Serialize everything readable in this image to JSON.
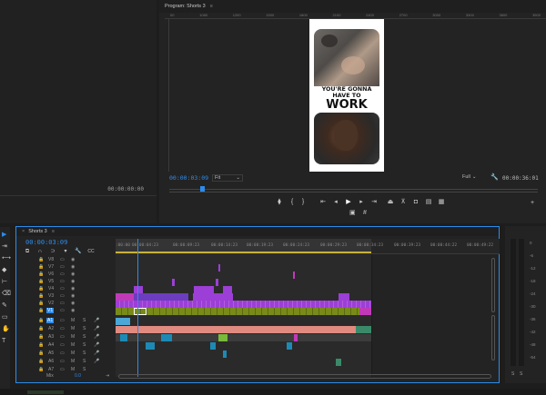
{
  "source": {
    "timecode": "00:00:00:00"
  },
  "program": {
    "title": "Program: Shorts 3",
    "menu_icon": "≡",
    "ruler_ticks": [
      "00",
      "1080",
      "1200",
      "1500",
      "1800",
      "2100",
      "2400",
      "2700",
      "3000",
      "3300",
      "3600",
      "3900"
    ],
    "caption_line1": "YOU'RE GONNA",
    "caption_line2": "HAVE TO",
    "caption_line3": "WORK",
    "current_tc": "00:00:03:09",
    "fit": "Fit",
    "quality": "Full",
    "duration_tc": "00:00:36:01"
  },
  "timeline": {
    "title": "Shorts 3",
    "close": "×",
    "current_tc": "00:00:03:09",
    "ruler": [
      ":00:00",
      "00:00:04:23",
      "00:00:09:23",
      "00:00:14:23",
      "00:00:19:23",
      "00:00:24:23",
      "00:00:29:23",
      "00:00:34:23",
      "00:00:39:23",
      "00:00:44:22",
      "00:00:49:22"
    ],
    "video_tracks": [
      "V8",
      "V7",
      "V6",
      "V5",
      "V4",
      "V3",
      "V2",
      "V1"
    ],
    "audio_tracks": [
      "A1",
      "A2",
      "A3",
      "A4",
      "A5",
      "A6",
      "A7"
    ],
    "mix_label": "Mix",
    "mix_value": "0.0",
    "m": "M",
    "s": "S"
  },
  "meter": {
    "scale": [
      "0",
      "-6",
      "-12",
      "-18",
      "-24",
      "-30",
      "-36",
      "-42",
      "-48",
      "-54"
    ],
    "solo_left": "S",
    "solo_right": "S"
  },
  "tools": [
    "▶",
    "⇥",
    "⟷",
    "◆",
    "⊢",
    "⌫",
    "✎",
    "▭",
    "✋",
    "T"
  ],
  "colors": {
    "accent": "#2d8ceb",
    "violet": "#9b3fd6",
    "magenta": "#c03ab8",
    "green": "#7a8a1a",
    "salmon": "#e08a80",
    "teal": "#1d8ab5"
  }
}
